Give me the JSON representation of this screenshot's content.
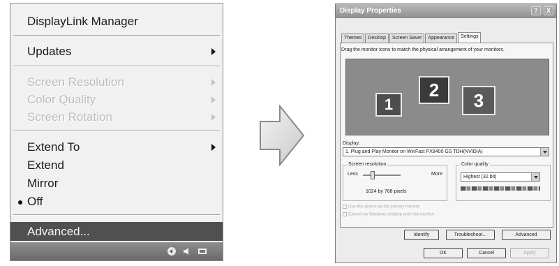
{
  "context_menu": {
    "title": "DisplayLink Manager",
    "updates": "Updates",
    "screen_resolution": "Screen Resolution",
    "color_quality": "Color Quality",
    "screen_rotation": "Screen Rotation",
    "extend_to": "Extend To",
    "extend": "Extend",
    "mirror": "Mirror",
    "off": "Off",
    "advanced": "Advanced..."
  },
  "dialog": {
    "title": "Display Properties",
    "tabs": [
      "Themes",
      "Desktop",
      "Screen Saver",
      "Appearance",
      "Settings"
    ],
    "instructions": "Drag the monitor icons to match the physical arrangement of your monitors.",
    "monitors": [
      "1",
      "2",
      "3"
    ],
    "display_label": "Display:",
    "display_value": "1. Plug and Play Monitor on WinFast PX8400 GS TDH(NVIDIA)",
    "resolution_label": "Screen resolution",
    "less": "Less",
    "more": "More",
    "resolution_value": "1024 by 768 pixels",
    "resolution_level": 0.25,
    "color_label": "Color quality",
    "color_value": "Highest (32 bit)",
    "primary_check": "Use this device as the primary monitor.",
    "extend_check": "Extend my Windows desktop onto this monitor.",
    "identify": "Identify",
    "troubleshoot": "Troubleshoot...",
    "advanced": "Advanced",
    "ok": "OK",
    "cancel": "Cancel",
    "apply": "Apply",
    "help_symbol": "?",
    "close_symbol": "X"
  }
}
